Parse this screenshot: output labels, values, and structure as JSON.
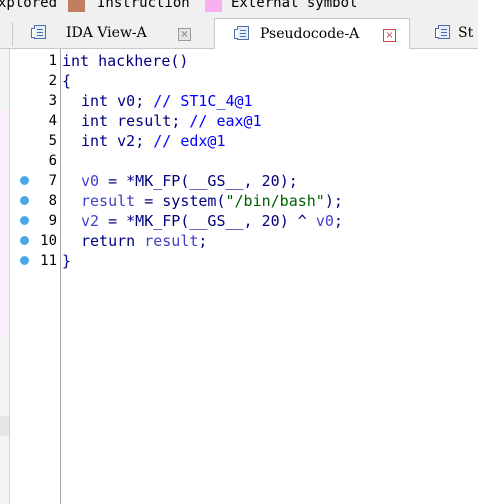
{
  "legend": {
    "items": [
      {
        "label": "xplored",
        "color": "#c8c8c8"
      },
      {
        "label": "Instruction",
        "color": "#c08060"
      },
      {
        "label": "External symbol",
        "color": "#f8b0f0"
      }
    ]
  },
  "tabs": [
    {
      "label": "IDA View-A",
      "active": false,
      "close": "×"
    },
    {
      "label": "Pseudocode-A",
      "active": true,
      "close": "×"
    },
    {
      "label": "St",
      "active": false
    }
  ],
  "gutter": {
    "line_numbers": [
      "1",
      "2",
      "3",
      "4",
      "5",
      "6",
      "7",
      "8",
      "9",
      "10",
      "11"
    ],
    "breakpoint_dots": [
      false,
      false,
      false,
      false,
      false,
      false,
      true,
      true,
      true,
      true,
      true
    ]
  },
  "code": {
    "l1": {
      "kw": "int",
      "name": " hackhere()"
    },
    "l2": {
      "text": "{"
    },
    "l3": {
      "kw": "int",
      "var": " v0",
      "semi": "; ",
      "comment": "// ST1C_4@1"
    },
    "l4": {
      "kw": "int",
      "var": " result",
      "semi": "; ",
      "comment": "// eax@1"
    },
    "l5": {
      "kw": "int",
      "var": " v2",
      "semi": "; ",
      "comment": "// edx@1"
    },
    "l7": {
      "var": "v0",
      "op": " = ",
      "call": "*MK_FP(__GS__, ",
      "num": "20",
      "end": ");"
    },
    "l8": {
      "var": "result",
      "op": " = ",
      "call": "system(",
      "str": "\"/bin/bash\"",
      "end": ");"
    },
    "l9": {
      "var": "v2",
      "op": " = ",
      "call": "*MK_FP(__GS__, ",
      "num": "20",
      "mid": ") ^ ",
      "var2": "v0",
      "end": ";"
    },
    "l10": {
      "kw": "return",
      "sp": " ",
      "var": "result",
      "end": ";"
    },
    "l11": {
      "text": "}"
    }
  }
}
